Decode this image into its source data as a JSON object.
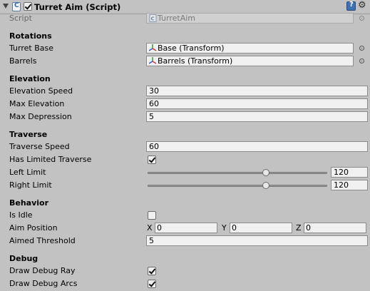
{
  "component": {
    "title": "Turret Aim (Script)",
    "enabled": true,
    "icons": {
      "foldout": "foldout-arrow-icon",
      "script": "csharp-script-icon",
      "help": "help-icon",
      "settings": "gear-icon"
    }
  },
  "script_field": {
    "label": "Script",
    "value": "TurretAim"
  },
  "rotations": {
    "header": "Rotations",
    "turret_base": {
      "label": "Turret Base",
      "value": "Base (Transform)"
    },
    "barrels": {
      "label": "Barrels",
      "value": "Barrels (Transform)"
    }
  },
  "elevation": {
    "header": "Elevation",
    "speed": {
      "label": "Elevation Speed",
      "value": "30"
    },
    "max_elevation": {
      "label": "Max Elevation",
      "value": "60"
    },
    "max_depression": {
      "label": "Max Depression",
      "value": "5"
    }
  },
  "traverse": {
    "header": "Traverse",
    "speed": {
      "label": "Traverse Speed",
      "value": "60"
    },
    "has_limited": {
      "label": "Has Limited Traverse",
      "checked": true
    },
    "left_limit": {
      "label": "Left Limit",
      "value": "120",
      "fraction": 0.667
    },
    "right_limit": {
      "label": "Right Limit",
      "value": "120",
      "fraction": 0.667
    }
  },
  "behavior": {
    "header": "Behavior",
    "is_idle": {
      "label": "Is Idle",
      "checked": false
    },
    "aim_position": {
      "label": "Aim Position",
      "x_label": "X",
      "x": "0",
      "y_label": "Y",
      "y": "0",
      "z_label": "Z",
      "z": "0"
    },
    "aimed_threshold": {
      "label": "Aimed Threshold",
      "value": "5"
    }
  },
  "debug": {
    "header": "Debug",
    "draw_ray": {
      "label": "Draw Debug Ray",
      "checked": true
    },
    "draw_arcs": {
      "label": "Draw Debug Arcs",
      "checked": true
    }
  },
  "colors": {
    "background": "#c2c2c2",
    "field": "#f0f0f0",
    "help_blue": "#3f6fb5"
  }
}
